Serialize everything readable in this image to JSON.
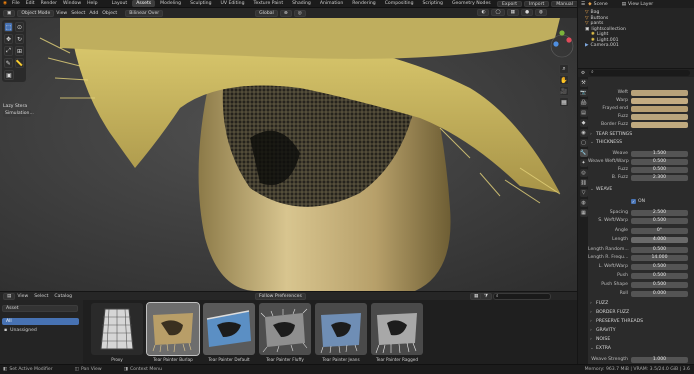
{
  "menu": {
    "items": [
      "File",
      "Edit",
      "Render",
      "Window",
      "Help"
    ],
    "workspaces": [
      "Layout",
      "Assets",
      "Modeling",
      "Sculpting",
      "UV Editing",
      "Texture Paint",
      "Shading",
      "Animation",
      "Rendering",
      "Compositing",
      "Scripting",
      "Geometry Nodes"
    ],
    "active_workspace": "Assets",
    "right_buttons": [
      "Export",
      "Import",
      "Manual"
    ],
    "scene": "Scene",
    "view_layer": "View Layer"
  },
  "viewport_header": {
    "mode": "Object Mode",
    "menus": [
      "View",
      "Select",
      "Add",
      "Object"
    ],
    "pivot": "Bilinear Over",
    "global": "Global",
    "options": "Options"
  },
  "tool_panel": {
    "items": [
      "Lazy Stera",
      "Simulation..."
    ]
  },
  "asset_browser": {
    "menus": [
      "View",
      "Select",
      "Catalog"
    ],
    "preferences_label": "Follow Preferences",
    "library_select": "Asset",
    "catalog_selected": "All",
    "catalog_unassigned": "Unassigned",
    "search_placeholder": "",
    "assets": [
      "Proxy",
      "Tear Painter Burlap",
      "Tear Painter Default",
      "Tear Painter Fluffy",
      "Tear Painter Jeans",
      "Tear Painter Ragged"
    ],
    "selected_index": 1
  },
  "statusbar": {
    "left": [
      "Set Active Modifier",
      "Pan View",
      "Context Menu"
    ],
    "right": "Memory: 963.7 MiB | VRAM: 3.5/24.0 GiB | 3.6"
  },
  "outliner": {
    "items": [
      "Bag",
      "Buttons",
      "pants",
      "lightscollection",
      "Light",
      "Light.001",
      "Camera.001"
    ]
  },
  "properties": {
    "color_rows": [
      {
        "label": "Weft",
        "color": "#b8a27a"
      },
      {
        "label": "Warp",
        "color": "#c4ac82"
      },
      {
        "label": "Frayed end",
        "color": "#b79f73"
      },
      {
        "label": "Fuzz",
        "color": "#b9a57d"
      },
      {
        "label": "Border Fuzz",
        "color": "#c0aa7f"
      }
    ],
    "tear_settings": "TEAR SETTINGS",
    "thickness": "THICKNESS",
    "thickness_rows": [
      {
        "label": "Weave",
        "value": "1.500"
      },
      {
        "label": "Weave Weft/Warp",
        "value": "0.500"
      },
      {
        "label": "Fuzz",
        "value": "0.500"
      },
      {
        "label": "B. Fuzz",
        "value": "2.300"
      }
    ],
    "weave": "WEAVE",
    "weave_on": "ON",
    "weave_rows": [
      {
        "label": "Spacing",
        "value": "2.500"
      },
      {
        "label": "S. Weft/Warp",
        "value": "0.500"
      },
      {
        "label": "Angle",
        "value": "0°"
      },
      {
        "label": "Length",
        "value": "4.000"
      },
      {
        "label": "Length Random...",
        "value": "0.500"
      },
      {
        "label": "Length R. Frequ...",
        "value": "14.000"
      },
      {
        "label": "L. Weft/Warp",
        "value": "0.500"
      },
      {
        "label": "Push",
        "value": "0.500"
      },
      {
        "label": "Push Shape",
        "value": "0.500"
      },
      {
        "label": "Roll",
        "value": "0.000"
      }
    ],
    "sections": [
      "FUZZ",
      "BORDER FUZZ",
      "PRESERVE THREADS",
      "GRAVITY",
      "NOISE",
      "EXTRA"
    ],
    "weave_strength_label": "Weave Strength",
    "weave_strength": "1.000"
  }
}
